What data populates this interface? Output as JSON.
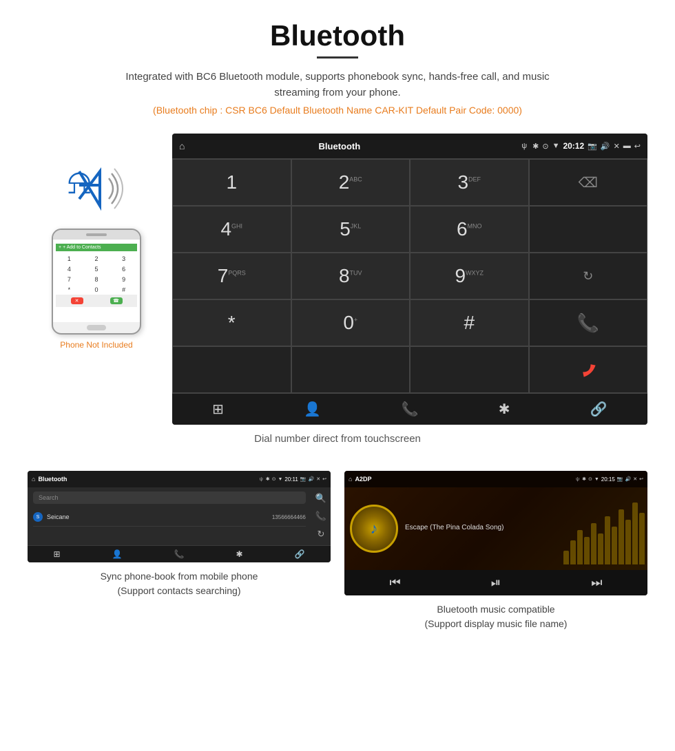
{
  "header": {
    "title": "Bluetooth",
    "underline": true,
    "subtitle": "Integrated with BC6 Bluetooth module, supports phonebook sync, hands-free call, and music streaming from your phone.",
    "specs": "(Bluetooth chip : CSR BC6    Default Bluetooth Name CAR-KIT    Default Pair Code: 0000)"
  },
  "car_screen": {
    "status_bar": {
      "title": "Bluetooth",
      "time": "20:12",
      "icons": [
        "⌂",
        "ψ",
        "✱",
        "⊙",
        "▼",
        "📷",
        "🔊",
        "✕",
        "▬",
        "↩"
      ]
    },
    "dialpad": {
      "keys": [
        {
          "num": "1",
          "sub": ""
        },
        {
          "num": "2",
          "sub": "ABC"
        },
        {
          "num": "3",
          "sub": "DEF"
        },
        {
          "num": "",
          "sub": "",
          "special": "delete"
        },
        {
          "num": "4",
          "sub": "GHI"
        },
        {
          "num": "5",
          "sub": "JKL"
        },
        {
          "num": "6",
          "sub": "MNO"
        },
        {
          "num": "",
          "sub": "",
          "special": "empty"
        },
        {
          "num": "7",
          "sub": "PQRS"
        },
        {
          "num": "8",
          "sub": "TUV"
        },
        {
          "num": "9",
          "sub": "WXYZ"
        },
        {
          "num": "",
          "sub": "",
          "special": "refresh"
        },
        {
          "num": "*",
          "sub": ""
        },
        {
          "num": "0",
          "sub": "+"
        },
        {
          "num": "#",
          "sub": ""
        },
        {
          "num": "",
          "sub": "",
          "special": "call-green"
        },
        {
          "num": "",
          "sub": "",
          "special": "empty2"
        },
        {
          "num": "",
          "sub": "",
          "special": "empty3"
        },
        {
          "num": "",
          "sub": "",
          "special": "empty4"
        },
        {
          "num": "",
          "sub": "",
          "special": "call-red"
        }
      ],
      "nav_icons": [
        "⊞",
        "👤",
        "📞",
        "✱",
        "🔗"
      ]
    },
    "label": "Dial number direct from touchscreen"
  },
  "phone": {
    "not_included": "Phone Not Included",
    "contact_bar_text": "+ Add to Contacts",
    "dialpad_keys": [
      "1",
      "2",
      "3",
      "4",
      "5",
      "6",
      "7",
      "8",
      "9",
      "*",
      "0",
      "#"
    ],
    "bottom_buttons": [
      "red",
      "green"
    ]
  },
  "bottom_left": {
    "status_bar": {
      "title": "Bluetooth",
      "time": "20:11"
    },
    "search_placeholder": "Search",
    "contacts": [
      {
        "letter": "S",
        "name": "Seicane",
        "number": "13566664466"
      }
    ],
    "side_icons": [
      "🔍",
      "📞",
      "🔄"
    ],
    "nav_icons": [
      "⊞",
      "👤",
      "📞",
      "✱",
      "🔗"
    ],
    "caption_line1": "Sync phone-book from mobile phone",
    "caption_line2": "(Support contacts searching)"
  },
  "bottom_right": {
    "status_bar": {
      "title": "A2DP",
      "time": "20:15"
    },
    "song_title": "Escape (The Pina Colada Song)",
    "controls": [
      "⏮",
      "⏯",
      "⏭"
    ],
    "caption_line1": "Bluetooth music compatible",
    "caption_line2": "(Support display music file name)"
  }
}
